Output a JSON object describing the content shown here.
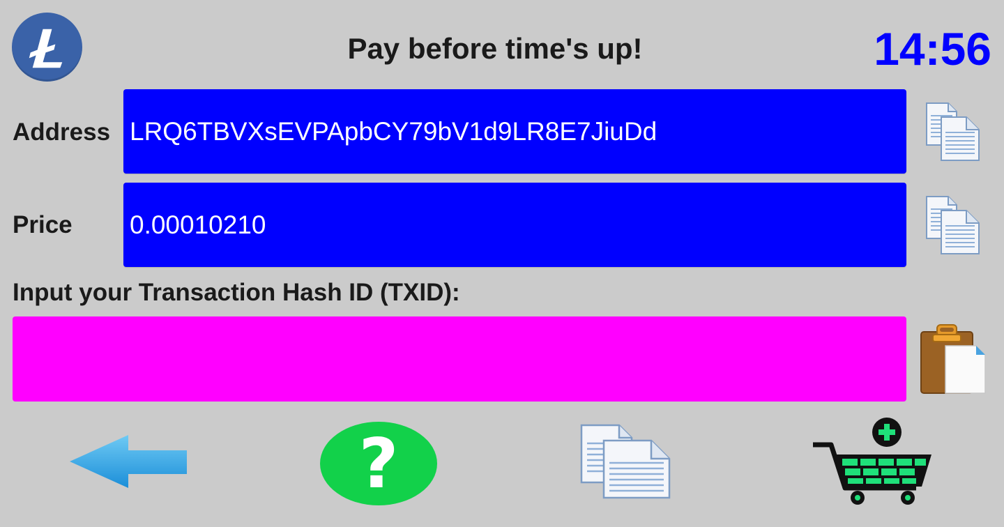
{
  "header": {
    "title": "Pay before time's up!",
    "timer": "14:56",
    "logo_icon": "litecoin-logo-icon"
  },
  "address": {
    "label": "Address",
    "value": "LRQ6TBVXsEVPApbCY79bV1d9LR8E7JiuDd",
    "copy_icon": "copy-icon"
  },
  "price": {
    "label": "Price",
    "value": "0.00010210",
    "copy_icon": "copy-icon"
  },
  "txid": {
    "label": "Input your Transaction Hash ID (TXID):",
    "value": "",
    "placeholder": "",
    "paste_icon": "paste-icon"
  },
  "toolbar": {
    "back_icon": "back-arrow-icon",
    "help_icon": "help-icon",
    "copy_icon": "copy-icon",
    "cart_icon": "add-to-cart-icon"
  },
  "colors": {
    "background": "#cbcbcb",
    "field_blue": "#0000ff",
    "txid_magenta": "#ff00ff",
    "timer_blue": "#0000ff",
    "help_green": "#12d14a",
    "cart_green": "#1fe07a",
    "logo_blue": "#3a62a8"
  }
}
